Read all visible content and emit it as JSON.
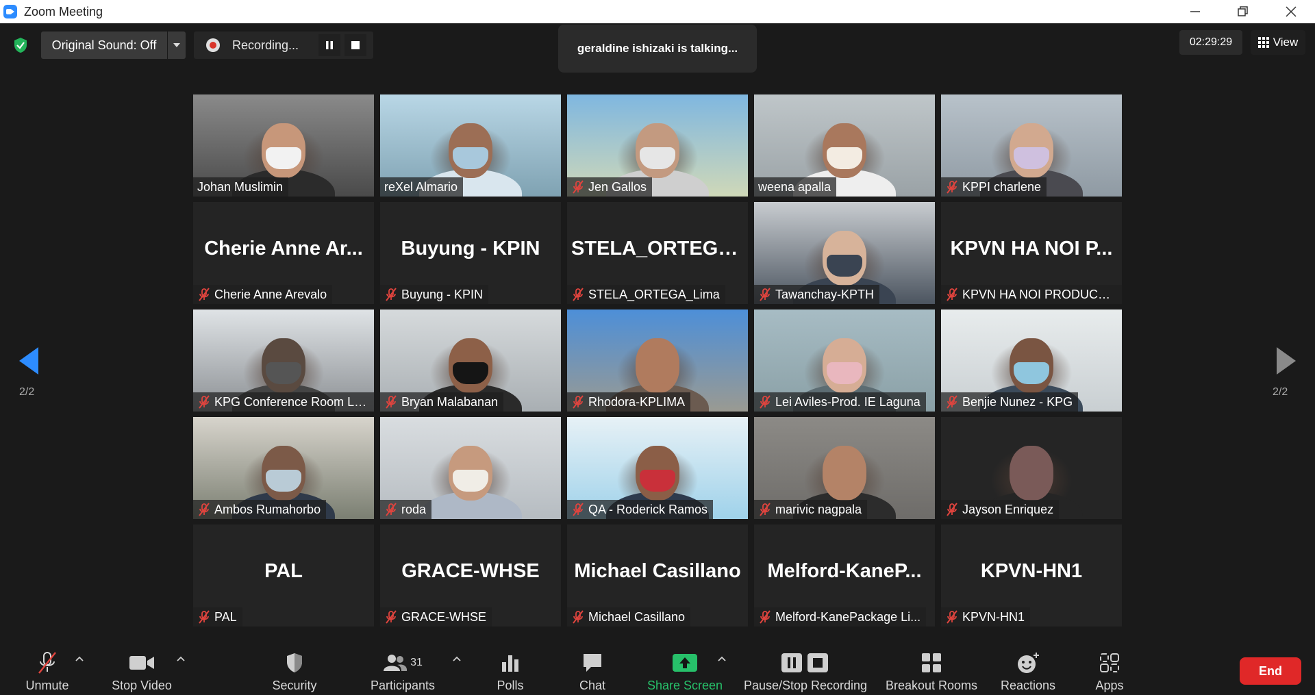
{
  "window": {
    "title": "Zoom Meeting"
  },
  "top": {
    "original_sound": "Original Sound: Off",
    "recording": "Recording...",
    "talking": "geraldine ishizaki is talking...",
    "timer": "02:29:29",
    "view": "View"
  },
  "page_indicator": "2/2",
  "participants": [
    {
      "name": "Johan Muslimin",
      "video": true,
      "muted": false,
      "c1": "#8a8a8a",
      "c2": "#4a4a4a",
      "skin": "#c7977a",
      "shirt": "#2b2b2b",
      "mask": "#f2f2f2"
    },
    {
      "name": "reXel Almario",
      "video": true,
      "muted": false,
      "c1": "#b9d7e6",
      "c2": "#7fa2b2",
      "skin": "#9c6e55",
      "shirt": "#d9e6ee",
      "mask": "#a8c8dc"
    },
    {
      "name": "Jen Gallos",
      "video": true,
      "muted": true,
      "c1": "#7fb7e0",
      "c2": "#cfd8b8",
      "skin": "#c39a80",
      "shirt": "#cfcfcf",
      "mask": "#e6e6e6"
    },
    {
      "name": "weena apalla",
      "video": true,
      "muted": false,
      "c1": "#bfc6c9",
      "c2": "#9aa2a6",
      "skin": "#a9785d",
      "shirt": "#eeeeee",
      "mask": "#f3ece2"
    },
    {
      "name": "KPPI charlene",
      "video": true,
      "muted": true,
      "c1": "#b8c2ca",
      "c2": "#8f9aa3",
      "skin": "#d2a98f",
      "shirt": "#4a4a50",
      "mask": "#cfc0df"
    },
    {
      "name": "Cherie Anne Arevalo",
      "display": "Cherie Anne Ar...",
      "video": false,
      "muted": true
    },
    {
      "name": "Buyung - KPIN",
      "display": "Buyung - KPIN",
      "video": false,
      "muted": true
    },
    {
      "name": "STELA_ORTEGA_Lima",
      "display": "STELA_ORTEGA...",
      "video": false,
      "muted": true
    },
    {
      "name": "Tawanchay-KPTH",
      "video": true,
      "muted": true,
      "c1": "#c8ccd0",
      "c2": "#4c5560",
      "skin": "#d7b39a",
      "shirt": "#3a4452",
      "mask": "#3a4452"
    },
    {
      "name": "KPVN HA NOI PRODUCTI...",
      "display": "KPVN HA NOI P...",
      "video": false,
      "muted": true
    },
    {
      "name": "KPG Conference Room La...",
      "video": true,
      "muted": true,
      "c1": "#dfe3e6",
      "c2": "#8c9094",
      "skin": "#5a4a40",
      "shirt": "#444444",
      "mask": "#555555"
    },
    {
      "name": "Bryan Malabanan",
      "video": true,
      "muted": true,
      "c1": "#d6dadc",
      "c2": "#a9afb3",
      "skin": "#8d6048",
      "shirt": "#2a2a2a",
      "mask": "#151515"
    },
    {
      "name": "Rhodora-KPLIMA",
      "video": true,
      "muted": true,
      "c1": "#4d8fd8",
      "c2": "#9a9a92",
      "skin": "#b07b5e",
      "shirt": "#6b5b50",
      "mask": "#b07b5e"
    },
    {
      "name": "Lei Aviles-Prod. IE Laguna",
      "video": true,
      "muted": true,
      "c1": "#a7bcc4",
      "c2": "#8aa0a6",
      "skin": "#d6ad95",
      "shirt": "#5c6c72",
      "mask": "#e9b7be"
    },
    {
      "name": "Benjie Nunez - KPG",
      "video": true,
      "muted": true,
      "c1": "#e8eced",
      "c2": "#c9cfd2",
      "skin": "#7a5542",
      "shirt": "#3b4a5a",
      "mask": "#8fc6de"
    },
    {
      "name": "Ambos Rumahorbo",
      "video": true,
      "muted": true,
      "c1": "#d7d4cc",
      "c2": "#7b7f72",
      "skin": "#7c5a48",
      "shirt": "#2f3a4a",
      "mask": "#b9cbd6"
    },
    {
      "name": "roda",
      "video": true,
      "muted": true,
      "c1": "#d9dde0",
      "c2": "#b6bcc1",
      "skin": "#c69a7e",
      "shirt": "#aeb8c6",
      "mask": "#f0ede6"
    },
    {
      "name": "QA - Roderick Ramos",
      "video": true,
      "muted": true,
      "c1": "#e7f1f6",
      "c2": "#9fd2ea",
      "skin": "#8b5e47",
      "shirt": "#2d3a4d",
      "mask": "#c9303a"
    },
    {
      "name": "marivic nagpala",
      "video": true,
      "muted": true,
      "c1": "#8c8a86",
      "c2": "#6e6c69",
      "skin": "#b48367",
      "shirt": "#2c2c2c",
      "mask": "#b48367"
    },
    {
      "name": "Jayson Enriquez",
      "video": true,
      "muted": true,
      "c1": "#252525",
      "c2": "#252525",
      "skin": "#7a5a58",
      "shirt": "#252525",
      "mask": "#7a5a58"
    },
    {
      "name": "PAL",
      "display": "PAL",
      "video": false,
      "muted": true
    },
    {
      "name": "GRACE-WHSE",
      "display": "GRACE-WHSE",
      "video": false,
      "muted": true
    },
    {
      "name": "Michael Casillano",
      "display": "Michael Casillano",
      "video": false,
      "muted": true
    },
    {
      "name": "Melford-KanePackage Li...",
      "display": "Melford-KaneP...",
      "video": false,
      "muted": true
    },
    {
      "name": "KPVN-HN1",
      "display": "KPVN-HN1",
      "video": false,
      "muted": true
    }
  ],
  "toolbar": {
    "unmute": "Unmute",
    "stop_video": "Stop Video",
    "security": "Security",
    "participants": "Participants",
    "participants_count": "31",
    "polls": "Polls",
    "chat": "Chat",
    "share_screen": "Share Screen",
    "pause_stop_recording": "Pause/Stop Recording",
    "breakout_rooms": "Breakout Rooms",
    "reactions": "Reactions",
    "apps": "Apps",
    "end": "End"
  },
  "colors": {
    "accent_blue": "#2d8cff",
    "share_green": "#27c06a",
    "end_red": "#e02828",
    "mute_red": "#e0443e"
  }
}
